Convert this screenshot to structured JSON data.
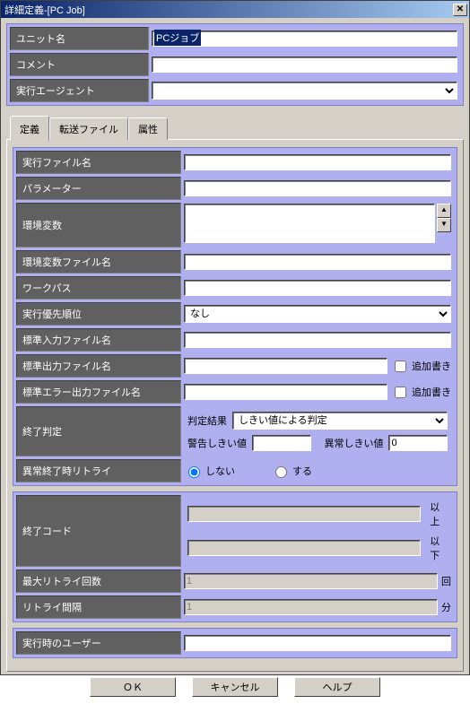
{
  "window": {
    "title": "詳細定義-[PC Job]"
  },
  "top": {
    "unit_name_label": "ユニット名",
    "unit_name_value": "PCジョブ",
    "comment_label": "コメント",
    "comment_value": "",
    "exec_agent_label": "実行エージェント",
    "exec_agent_value": ""
  },
  "tabs": {
    "def": "定義",
    "transfer": "転送ファイル",
    "attr": "属性"
  },
  "def": {
    "exec_file_label": "実行ファイル名",
    "exec_file_value": "",
    "param_label": "パラメーター",
    "param_value": "",
    "env_var_label": "環境変数",
    "env_var_value": "",
    "env_file_label": "環境変数ファイル名",
    "env_file_value": "",
    "workpath_label": "ワークパス",
    "workpath_value": "",
    "priority_label": "実行優先順位",
    "priority_value": "なし",
    "stdin_label": "標準入力ファイル名",
    "stdin_value": "",
    "stdout_label": "標準出力ファイル名",
    "stdout_value": "",
    "stderr_label": "標準エラー出力ファイル名",
    "stderr_value": "",
    "append_label": "追加書き",
    "end_judge_label": "終了判定",
    "judge_result_label": "判定結果",
    "judge_result_value": "しきい値による判定",
    "warn_thresh_label": "警告しきい値",
    "warn_thresh_value": "",
    "abnorm_thresh_label": "異常しきい値",
    "abnorm_thresh_value": "0",
    "retry_label": "異常終了時リトライ",
    "retry_no": "しない",
    "retry_yes": "する",
    "end_code_label": "終了コード",
    "end_code_ge": "以上",
    "end_code_le": "以下",
    "max_retry_label": "最大リトライ回数",
    "max_retry_value": "1",
    "max_retry_unit": "回",
    "retry_interval_label": "リトライ間隔",
    "retry_interval_value": "1",
    "retry_interval_unit": "分",
    "exec_user_label": "実行時のユーザー",
    "exec_user_value": ""
  },
  "buttons": {
    "ok": "ＯＫ",
    "cancel": "キャンセル",
    "help": "ヘルプ"
  }
}
